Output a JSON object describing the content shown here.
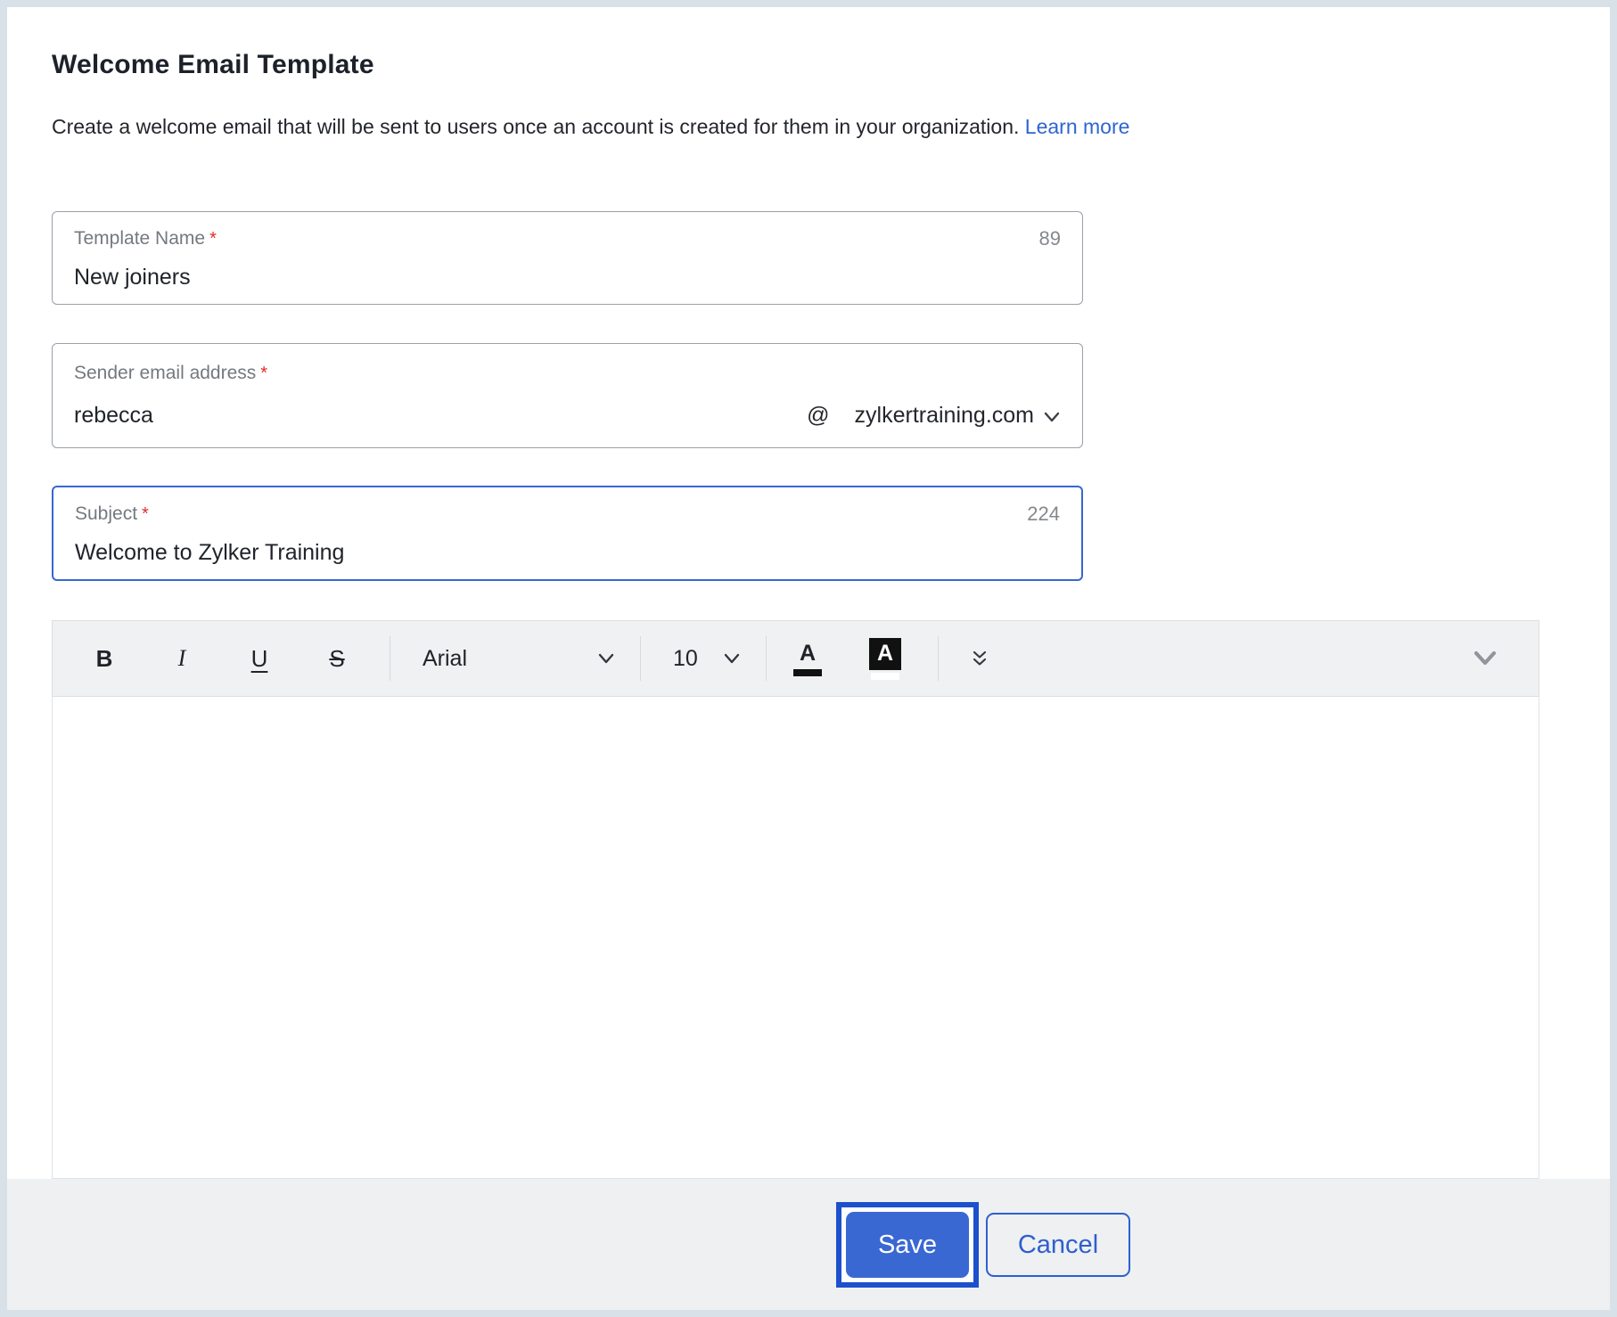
{
  "page": {
    "title": "Welcome Email Template",
    "description": "Create a welcome email that will be sent to users once an account is created for them in your organization.",
    "learn_more_label": "Learn more"
  },
  "marks": {
    "required": "*"
  },
  "fields": {
    "template_name": {
      "label": "Template Name",
      "value": "New joiners",
      "remaining_chars": "89"
    },
    "sender_email": {
      "label": "Sender email address",
      "local_part": "rebecca",
      "at_sign": "@",
      "domain": "zylkertraining.com"
    },
    "subject": {
      "label": "Subject",
      "value": "Welcome to Zylker Training",
      "remaining_chars": "224"
    }
  },
  "editor": {
    "toolbar": {
      "bold_label": "B",
      "italic_label": "I",
      "underline_label": "U",
      "strikethrough_label": "S",
      "font_family_value": "Arial",
      "font_size_value": "10",
      "font_color_label": "A",
      "highlight_color_label": "A"
    },
    "body_text": ""
  },
  "footer": {
    "save_label": "Save",
    "cancel_label": "Cancel"
  },
  "colors": {
    "accent_blue": "#3a68d3",
    "focus_ring_blue": "#1d50cc",
    "link_blue": "#2e64d2",
    "required_red": "#e02b2b",
    "field_border_gray": "#99a0a8",
    "toolbar_bg": "#f0f1f3",
    "footer_bg": "#eef0f2",
    "outer_frame": "#d9e1e8"
  }
}
